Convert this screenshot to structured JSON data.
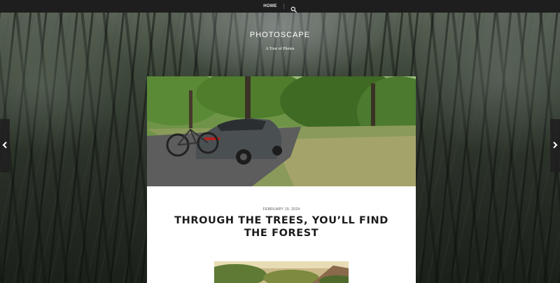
{
  "nav": {
    "items": [
      {
        "label": "HOME"
      }
    ],
    "search_icon": "search-icon"
  },
  "site": {
    "title": "PHOTOSCAPE",
    "tagline": "A Tour of Photos"
  },
  "post": {
    "date": "FEBRUARY 19, 2024",
    "title": "THROUGH THE TREES, YOU’LL FIND THE FOREST"
  },
  "controls": {
    "prev_icon": "chevron-left-icon",
    "next_icon": "chevron-right-icon"
  },
  "colors": {
    "topbar": "#1e1e1e",
    "card": "#ffffff",
    "title_text": "#1b1b1b"
  }
}
